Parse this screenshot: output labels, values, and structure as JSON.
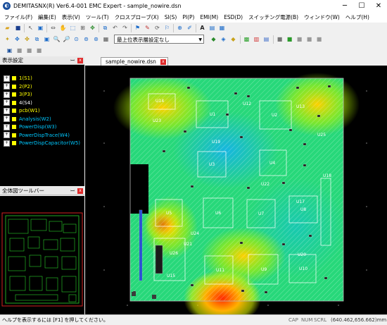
{
  "window": {
    "title": "DEMITASNX(R) Ver6.4-001 EMC Expert - sample_nowire.dsn",
    "app_icon": "globe-icon",
    "minimize": "─",
    "maximize": "☐",
    "close": "✕"
  },
  "menu": [
    "ファイル(F)",
    "編集(E)",
    "表示(V)",
    "ツール(T)",
    "クロスプローブ(X)",
    "SI(S)",
    "PI(P)",
    "EMI(M)",
    "ESD(D)",
    "スイッチング電源(B)",
    "ウィンドウ(W)",
    "ヘルプ(H)"
  ],
  "toolbar": {
    "layer_combo": "最上位表示層設定なし",
    "combo_arrow": "▼"
  },
  "layer_panel": {
    "title": "表示設定",
    "pin": "ꟷ",
    "close": "x",
    "layers": [
      {
        "label": "1(S1)",
        "color": "#ffff00",
        "swatch": "#ffff00",
        "type": "folder"
      },
      {
        "label": "2(P2)",
        "color": "#ffff00",
        "swatch": "#ffff00",
        "type": "folder"
      },
      {
        "label": "3(P3)",
        "color": "#ffff00",
        "swatch": "#ffff00",
        "type": "folder"
      },
      {
        "label": "4(S4)",
        "color": "#ffffff",
        "swatch": "#ffff00",
        "type": "folder"
      },
      {
        "label": "pcb(W1)",
        "color": "#ffff00",
        "swatch": "#ffff00",
        "type": "doc"
      },
      {
        "label": "Analysis(W2)",
        "color": "#00c8ff",
        "swatch": "#ffff00",
        "type": "doc"
      },
      {
        "label": "PowerDisp(W3)",
        "color": "#00c8ff",
        "swatch": "#ffff00",
        "type": "doc"
      },
      {
        "label": "PowerDispTrace(W4)",
        "color": "#00c8ff",
        "swatch": "#ffff00",
        "type": "doc"
      },
      {
        "label": "PowerDispCapacitor(W5)",
        "color": "#00c8ff",
        "swatch": "#ffff00",
        "type": "doc"
      }
    ]
  },
  "overview_panel": {
    "title": "全体図ツールバー",
    "pin": "ꟷ",
    "close": "x"
  },
  "document_tab": {
    "label": "sample_nowire.dsn",
    "close": "x"
  },
  "board": {
    "components": [
      "U14",
      "U1",
      "U2",
      "U3",
      "U4",
      "U5",
      "U6",
      "U7",
      "U8",
      "U9",
      "U10",
      "U11",
      "U12",
      "U13",
      "U15",
      "U17",
      "U18",
      "U19",
      "U20",
      "U21",
      "U22",
      "U23",
      "U24",
      "U25",
      "U26"
    ]
  },
  "status": {
    "help": "ヘルプを表示するには [F1] を押してください。",
    "cap": "CAP",
    "num": "NUM",
    "scrl": "SCRL",
    "coords": "(640.462,656.662)mm"
  }
}
